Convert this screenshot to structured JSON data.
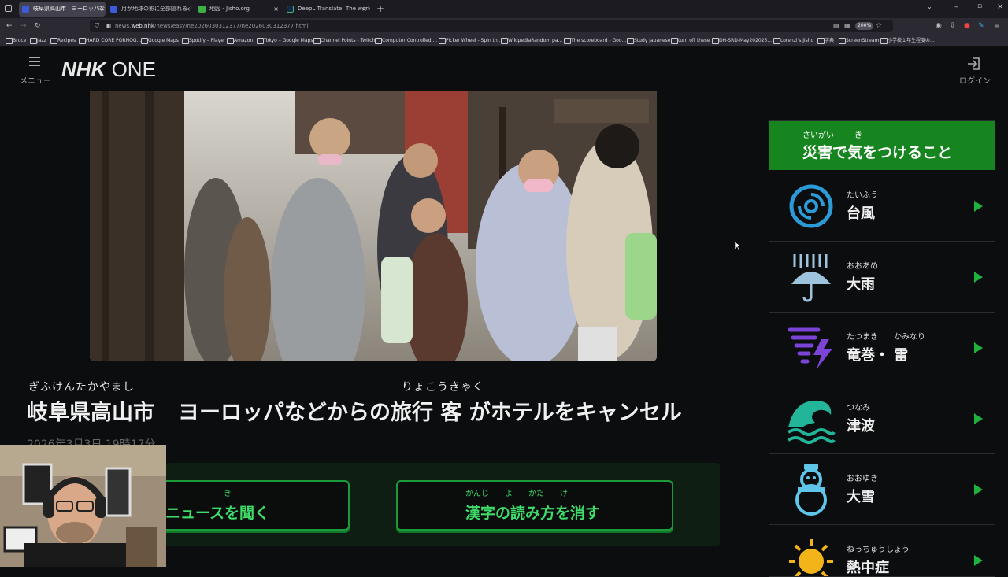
{
  "browser": {
    "tabs": [
      {
        "title": "岐阜県高山市　ヨーロッパなど",
        "active": true,
        "color": "#3b5bdb"
      },
      {
        "title": "月が地球の影に全部隠れる「皆",
        "active": false,
        "color": "#3b5bdb"
      },
      {
        "title": "地図 - Jisho.org",
        "active": false,
        "color": "#3fae49"
      },
      {
        "title": "DeepL Translate: The world's m",
        "active": false,
        "color": "#0f2b46"
      }
    ],
    "new_tab_label": "+",
    "close_glyph": "×",
    "url_prefix": "news.",
    "url_domain": "web.nhk",
    "url_path": "/news/easy/ne2026030312377/ne2026030312377.html",
    "zoom": "200%",
    "bookmarks": [
      "Bruce",
      "Jazz",
      "Recipes",
      "HARD CORE PORNOG...",
      "Google Maps",
      "Spotify – Player",
      "Amazon",
      "Tokyo – Google Maps",
      "Channel Points - Twitch",
      "Computer Controlled ...",
      "Picker Wheel - Spin th...",
      "WikipediaRandom pa...",
      "The scoreboard - Goo...",
      "Study Japanese",
      "turn off these",
      "DH-SRD-May202025...",
      "Lorenzi's Jisho",
      "字典",
      "ScreenStream",
      "小学校１年生程度の..."
    ]
  },
  "header": {
    "menu_label": "メニュー",
    "logo_nhk": "NHK",
    "logo_one": "ONE",
    "login_label": "ログイン"
  },
  "article": {
    "title_part1": "岐阜県高山市",
    "title_part2": "ヨーロッパなどからの旅行 客 がホテルをキャンセル",
    "ruby_1": "ぎふけんたかやまし",
    "ruby_2": "りょこうきゃく",
    "date": "2026年3月3日 19時17分"
  },
  "buttons": {
    "listen_ruby": "き",
    "listen_label": "ニュースを聞く",
    "furigana_ruby": "かんじ　　よ　　かた　　け",
    "furigana_label": "漢字の読み方を消す"
  },
  "panel": {
    "title": "災害で気をつけること",
    "ruby_saigai": "さいがい",
    "ruby_ki": "き",
    "items": [
      {
        "yomi": "たいふう",
        "name": "台風",
        "icon": "typhoon-icon",
        "color": "#2d9ad8"
      },
      {
        "yomi": "おおあめ",
        "name": "大雨",
        "icon": "umbrella-rain-icon",
        "color": "#9ec4dd"
      },
      {
        "yomi": "たつまき　　かみなり",
        "name": "竜巻・ 雷",
        "icon": "tornado-lightning-icon",
        "color": "#7b43d6"
      },
      {
        "yomi": "つなみ",
        "name": "津波",
        "icon": "tsunami-icon",
        "color": "#23b59a"
      },
      {
        "yomi": "おおゆき",
        "name": "大雪",
        "icon": "snowman-icon",
        "color": "#5fc6ea"
      },
      {
        "yomi": "ねっちゅうしょう",
        "name": "熱中症",
        "icon": "sun-heat-icon",
        "color": "#f2b418"
      }
    ]
  }
}
